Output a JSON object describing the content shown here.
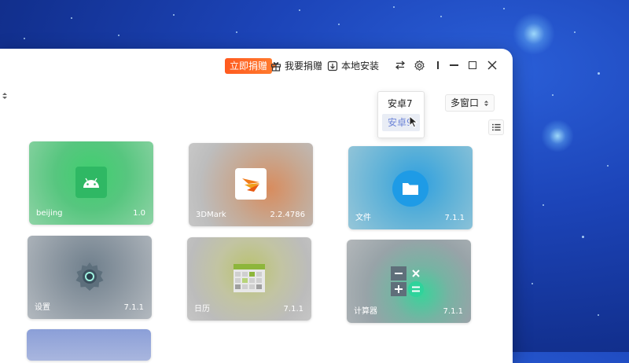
{
  "titlebar": {
    "donate_now": "立即捐赠",
    "i_want_donate": "我要捐赠",
    "local_install": "本地安装"
  },
  "version_dropdown": {
    "options": [
      "安卓7",
      "安卓9"
    ],
    "selected": "安卓9"
  },
  "multiwindow_label": "多窗口",
  "apps": [
    {
      "name": "beijing",
      "version": "1.0",
      "icon": "android-icon"
    },
    {
      "name": "3DMark",
      "version": "2.2.4786",
      "icon": "3dmark-icon"
    },
    {
      "name": "文件",
      "version": "7.1.1",
      "icon": "folder-icon"
    },
    {
      "name": "设置",
      "version": "7.1.1",
      "icon": "gear-icon"
    },
    {
      "name": "日历",
      "version": "7.1.1",
      "icon": "calendar-icon"
    },
    {
      "name": "计算器",
      "version": "7.1.1",
      "icon": "calculator-icon"
    }
  ],
  "colors": {
    "donate_accent": "#ff5a1f",
    "selected_option": "#6f86d8",
    "desktop_blue": "#1c44b8"
  }
}
